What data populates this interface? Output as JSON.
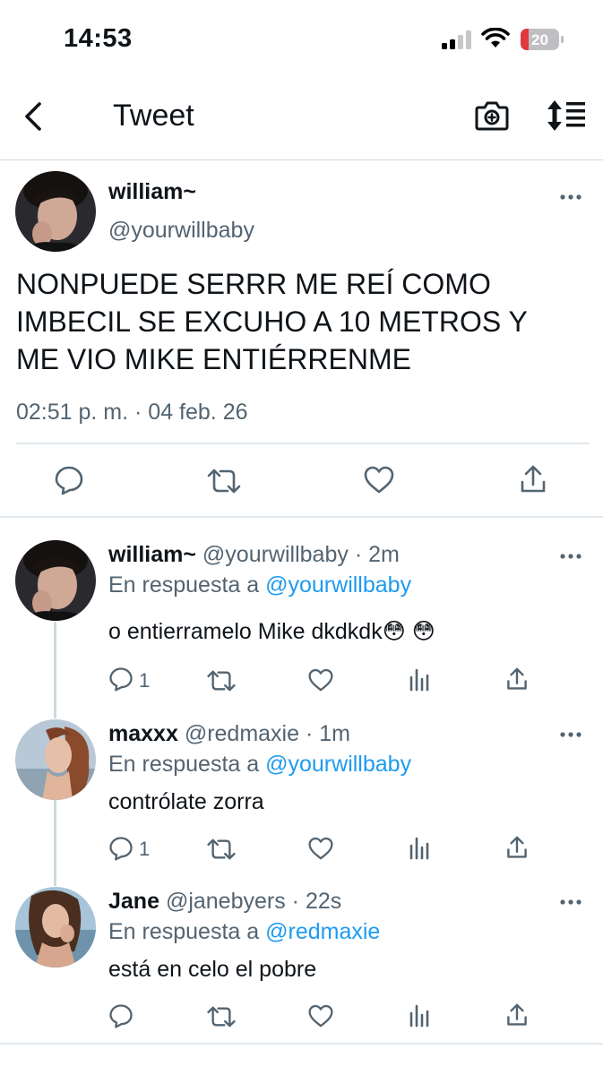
{
  "status_bar": {
    "time": "14:53",
    "battery": "20"
  },
  "nav": {
    "title": "Tweet"
  },
  "tweet": {
    "name": "william~",
    "handle": "@yourwillbaby",
    "text_lines": [
      "NONPUEDE SERRR ME REÍ COMO",
      "IMBECIL SE EXCUHO A 10 METROS Y",
      "ME VIO MIKE ENTIÉRRENME"
    ],
    "date": "02:51 p. m. · 04 feb. 26"
  },
  "replies": [
    {
      "name": "william~",
      "handle": "@yourwillbaby",
      "time": "· 2m",
      "in_reply_prefix": "En respuesta a ",
      "in_reply_to": "@yourwillbaby",
      "text": "o entierramelo Mike dkdkdk😳 😳",
      "reply_count": "1"
    },
    {
      "name": "maxxx",
      "handle": "@redmaxie",
      "time": "· 1m",
      "in_reply_prefix": "En respuesta a ",
      "in_reply_to": "@yourwillbaby",
      "text": "contrólate zorra",
      "reply_count": "1"
    },
    {
      "name": "Jane",
      "handle": "@janebyers",
      "time": "· 22s",
      "in_reply_prefix": "En respuesta a ",
      "in_reply_to": "@redmaxie",
      "text": "está en celo el pobre",
      "reply_count": ""
    }
  ],
  "colors": {
    "link": "#1d9bf0",
    "secondary": "#536471",
    "text": "#0f1419",
    "battery_low": "#e0393e"
  }
}
